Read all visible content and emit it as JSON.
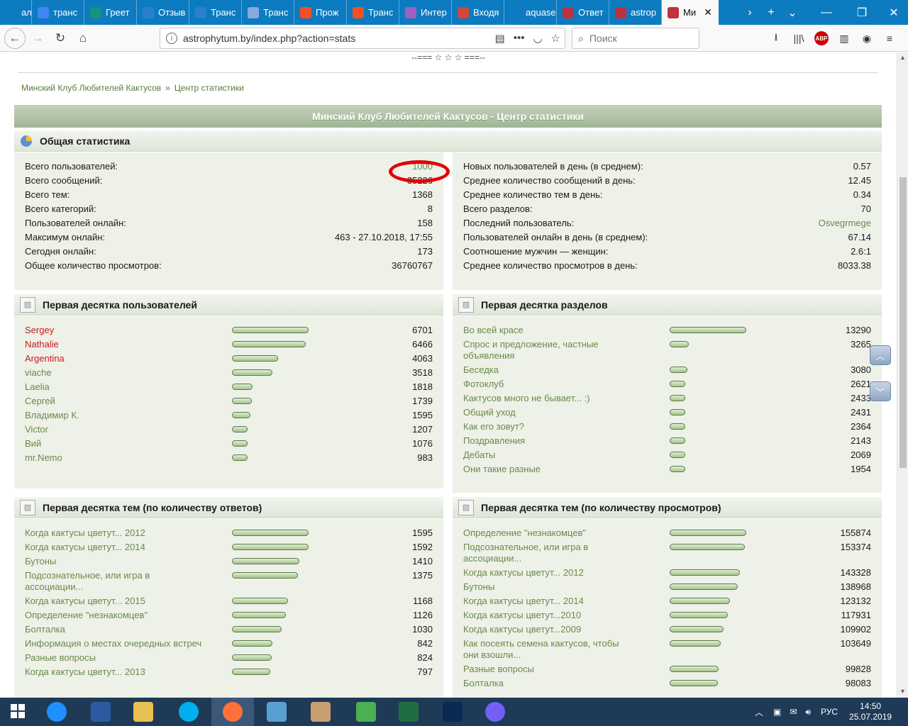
{
  "browser": {
    "tabs": [
      {
        "label": "ал",
        "color": "#0c7bbf",
        "active": false
      },
      {
        "label": "транс",
        "color": "#4285f4",
        "active": false
      },
      {
        "label": "Греет",
        "color": "#12967a",
        "active": false
      },
      {
        "label": "Отзыв",
        "color": "#2b7fd0",
        "active": false
      },
      {
        "label": "Транс",
        "color": "#2b7fd0",
        "active": false
      },
      {
        "label": "Транс",
        "color": "#8aa8e0",
        "active": false
      },
      {
        "label": "Прож",
        "color": "#f25022",
        "active": false
      },
      {
        "label": "Транс",
        "color": "#f25022",
        "active": false
      },
      {
        "label": "Интер",
        "color": "#a05fc0",
        "active": false
      },
      {
        "label": "Входя",
        "color": "#d44638",
        "active": false
      },
      {
        "label": "aquasecto",
        "color": "#0c7bbf",
        "active": false
      },
      {
        "label": "Ответ",
        "color": "#c03040",
        "active": false
      },
      {
        "label": "astrop",
        "color": "#c03040",
        "active": false
      },
      {
        "label": "Ми",
        "color": "#c03040",
        "active": true
      }
    ],
    "url": "astrophytum.by/index.php?action=stats",
    "search_placeholder": "Поиск",
    "abp": "ABP"
  },
  "page": {
    "stars": "--=== ☆ ☆ ☆ ===--",
    "breadcrumb": {
      "home": "Минский Клуб Любителей Кактусов",
      "sep": "»",
      "current": "Центр статистики"
    },
    "title": "Минский Клуб Любителей Кактусов - Центр статистики",
    "general": {
      "header": "Общая статистика",
      "left": [
        {
          "label": "Всего пользователей:",
          "value": "1000"
        },
        {
          "label": "Всего сообщений:",
          "value": "35226"
        },
        {
          "label": "Всего тем:",
          "value": "1368"
        },
        {
          "label": "Всего категорий:",
          "value": "8"
        },
        {
          "label": "Пользователей онлайн:",
          "value": "158"
        },
        {
          "label": "Максимум онлайн:",
          "value": "463 - 27.10.2018, 17:55"
        },
        {
          "label": "Сегодня онлайн:",
          "value": "173"
        },
        {
          "label": "Общее количество просмотров:",
          "value": "36760767"
        }
      ],
      "right": [
        {
          "label": "Новых пользователей в день (в среднем):",
          "value": "0.57"
        },
        {
          "label": "Среднее количество сообщений в день:",
          "value": "12.45"
        },
        {
          "label": "Среднее количество тем в день:",
          "value": "0.34"
        },
        {
          "label": "Всего разделов:",
          "value": "70"
        },
        {
          "label": "Последний пользователь:",
          "value": "Osvegrmege"
        },
        {
          "label": "Пользователей онлайн в день (в среднем):",
          "value": "67.14"
        },
        {
          "label": "Соотношение мужчин — женщин:",
          "value": "2.6:1"
        },
        {
          "label": "Среднее количество просмотров в день:",
          "value": "8033.38"
        }
      ]
    },
    "top_users": {
      "header": "Первая десятка пользователей",
      "max": 6701,
      "items": [
        {
          "name": "Sergey",
          "value": 6701,
          "red": true
        },
        {
          "name": "Nathalie",
          "value": 6466,
          "red": true
        },
        {
          "name": "Argentina",
          "value": 4063,
          "red": true
        },
        {
          "name": "viache",
          "value": 3518,
          "red": false
        },
        {
          "name": "Laelia",
          "value": 1818,
          "red": false
        },
        {
          "name": "Сергей",
          "value": 1739,
          "red": false
        },
        {
          "name": "Владимир К.",
          "value": 1595,
          "red": false
        },
        {
          "name": "Victor",
          "value": 1207,
          "red": false
        },
        {
          "name": "Вий",
          "value": 1076,
          "red": false
        },
        {
          "name": "mr.Nemo",
          "value": 983,
          "red": false
        }
      ]
    },
    "top_boards": {
      "header": "Первая десятка разделов",
      "max": 13290,
      "items": [
        {
          "name": "Во всей красе",
          "value": 13290,
          "lines": 1
        },
        {
          "name": "Спрос и предложение, частные объявления",
          "value": 3265,
          "lines": 2
        },
        {
          "name": "Беседка",
          "value": 3080,
          "lines": 1
        },
        {
          "name": "Фотоклуб",
          "value": 2621,
          "lines": 1
        },
        {
          "name": "Кактусов много не бывает... :)",
          "value": 2433,
          "lines": 1
        },
        {
          "name": "Общий уход",
          "value": 2431,
          "lines": 1
        },
        {
          "name": "Как его зовут?",
          "value": 2364,
          "lines": 1
        },
        {
          "name": "Поздравления",
          "value": 2143,
          "lines": 1
        },
        {
          "name": "Дебаты",
          "value": 2069,
          "lines": 1
        },
        {
          "name": "Они такие разные",
          "value": 1954,
          "lines": 1
        }
      ]
    },
    "top_topics_replies": {
      "header": "Первая десятка тем (по количеству ответов)",
      "max": 1595,
      "items": [
        {
          "name": "Когда кактусы цветут... 2012",
          "value": 1595,
          "lines": 1
        },
        {
          "name": "Когда кактусы цветут... 2014",
          "value": 1592,
          "lines": 1
        },
        {
          "name": "Бутоны",
          "value": 1410,
          "lines": 1
        },
        {
          "name": "Подсознательное, или игра в ассоциации...",
          "value": 1375,
          "lines": 2
        },
        {
          "name": "Когда кактусы цветут... 2015",
          "value": 1168,
          "lines": 1
        },
        {
          "name": "Определение \"незнакомцев\"",
          "value": 1126,
          "lines": 1
        },
        {
          "name": "Болталка",
          "value": 1030,
          "lines": 1
        },
        {
          "name": "Информация о местах очередных встреч",
          "value": 842,
          "lines": 1
        },
        {
          "name": "Разные вопросы",
          "value": 824,
          "lines": 1
        },
        {
          "name": "Когда кактусы цветут... 2013",
          "value": 797,
          "lines": 1
        }
      ]
    },
    "top_topics_views": {
      "header": "Первая десятка тем (по количеству просмотров)",
      "max": 155874,
      "items": [
        {
          "name": "Определение \"незнакомцев\"",
          "value": 155874,
          "lines": 1
        },
        {
          "name": "Подсознательное, или игра в ассоциации...",
          "value": 153374,
          "lines": 2
        },
        {
          "name": "Когда кактусы цветут... 2012",
          "value": 143328,
          "lines": 1
        },
        {
          "name": "Бутоны",
          "value": 138968,
          "lines": 1
        },
        {
          "name": "Когда кактусы цветут... 2014",
          "value": 123132,
          "lines": 1
        },
        {
          "name": "Когда кактусы цветут...2010",
          "value": 117931,
          "lines": 1
        },
        {
          "name": "Когда кактусы цветут...2009",
          "value": 109902,
          "lines": 1
        },
        {
          "name": "Как посеять семена кактусов, чтобы они взошли...",
          "value": 103649,
          "lines": 2
        },
        {
          "name": "Разные вопросы",
          "value": 99828,
          "lines": 1
        },
        {
          "name": "Болталка",
          "value": 98083,
          "lines": 1
        }
      ]
    }
  },
  "taskbar": {
    "apps": [
      {
        "name": "windows-start",
        "color": "#ffffff"
      },
      {
        "name": "ie",
        "color": "#1e90ff"
      },
      {
        "name": "save",
        "color": "#2c5aa0"
      },
      {
        "name": "explorer",
        "color": "#e8c050"
      },
      {
        "name": "skype",
        "color": "#00aff0"
      },
      {
        "name": "firefox",
        "color": "#ff7139"
      },
      {
        "name": "network",
        "color": "#5a9fd4"
      },
      {
        "name": "paint",
        "color": "#c8a070"
      },
      {
        "name": "corel",
        "color": "#4caf50"
      },
      {
        "name": "excel",
        "color": "#1d6f42"
      },
      {
        "name": "photoshop",
        "color": "#0a2a52"
      },
      {
        "name": "viber",
        "color": "#7360f2"
      }
    ],
    "lang": "РУС",
    "time": "14:50",
    "date": "25.07.2019"
  }
}
